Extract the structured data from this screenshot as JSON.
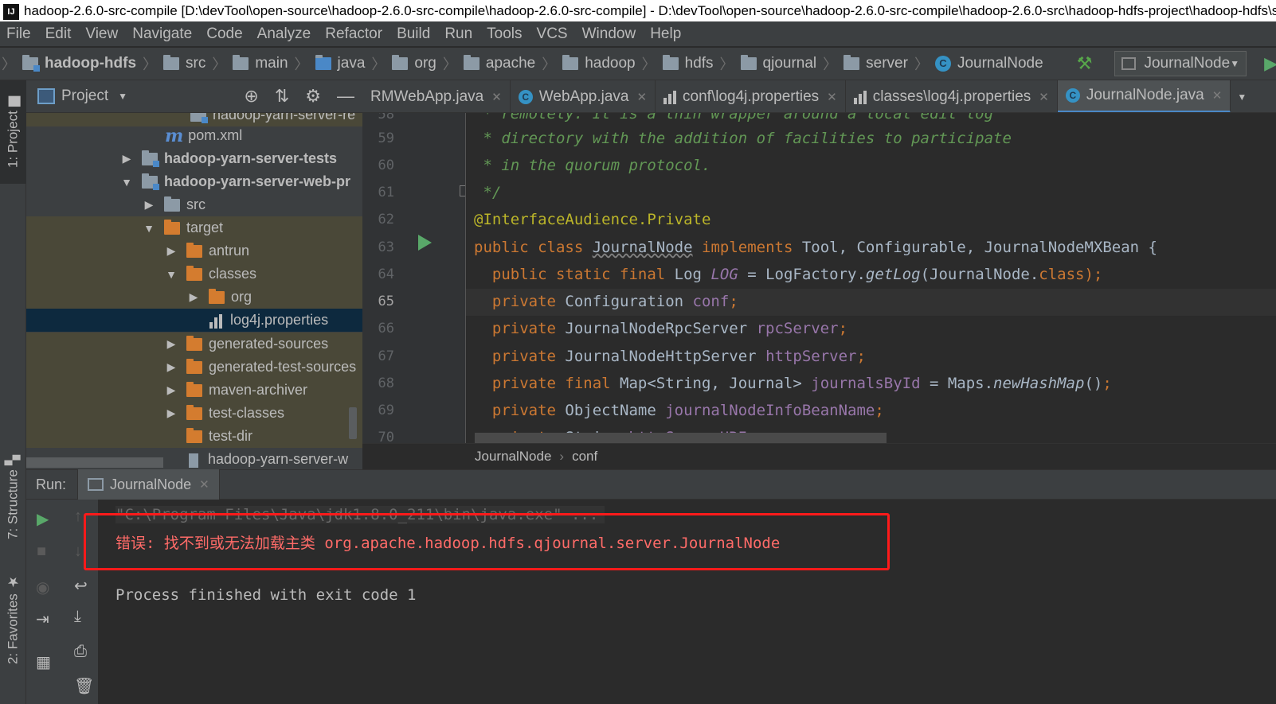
{
  "window": {
    "title": "hadoop-2.6.0-src-compile [D:\\devTool\\open-source\\hadoop-2.6.0-src-compile\\hadoop-2.6.0-src-compile] - D:\\devTool\\open-source\\hadoop-2.6.0-src-compile\\hadoop-2.6.0-src\\hadoop-hdfs-project\\hadoop-hdfs\\src\\main\\java\\org\\apache\\hadoop\\hdfs\\qjournal\\server\\JournalNode.java"
  },
  "menu": [
    "File",
    "Edit",
    "View",
    "Navigate",
    "Code",
    "Analyze",
    "Refactor",
    "Build",
    "Run",
    "Tools",
    "VCS",
    "Window",
    "Help"
  ],
  "nav": {
    "crumbs": [
      "hadoop-hdfs",
      "src",
      "main",
      "java",
      "org",
      "apache",
      "hadoop",
      "hdfs",
      "qjournal",
      "server",
      "JournalNode"
    ],
    "run_config": "JournalNode"
  },
  "left_stripe": {
    "project": "1: Project",
    "structure": "7: Structure",
    "favorites": "2: Favorites"
  },
  "project_panel": {
    "title": "Project",
    "tree": [
      {
        "label": "hadoop-yarn-server-re",
        "kind": "module"
      },
      {
        "label": "pom.xml",
        "kind": "pom"
      },
      {
        "label": "hadoop-yarn-server-tests",
        "kind": "module"
      },
      {
        "label": "hadoop-yarn-server-web-pr",
        "kind": "module"
      },
      {
        "label": "src",
        "kind": "folder"
      },
      {
        "label": "target",
        "kind": "folder"
      },
      {
        "label": "antrun",
        "kind": "folder"
      },
      {
        "label": "classes",
        "kind": "folder"
      },
      {
        "label": "org",
        "kind": "folder"
      },
      {
        "label": "log4j.properties",
        "kind": "properties"
      },
      {
        "label": "generated-sources",
        "kind": "folder"
      },
      {
        "label": "generated-test-sources",
        "kind": "folder"
      },
      {
        "label": "maven-archiver",
        "kind": "folder"
      },
      {
        "label": "test-classes",
        "kind": "folder"
      },
      {
        "label": "test-dir",
        "kind": "folder"
      },
      {
        "label": "hadoop-yarn-server-w",
        "kind": "file"
      }
    ]
  },
  "editor": {
    "tabs": [
      "RMWebApp.java",
      "WebApp.java",
      "conf\\log4j.properties",
      "classes\\log4j.properties",
      "JournalNode.java"
    ],
    "active_tab": "JournalNode.java",
    "line_numbers": [
      "58",
      "59",
      "60",
      "61",
      "62",
      "63",
      "64",
      "65",
      "66",
      "67",
      "68",
      "69",
      "70"
    ],
    "current_line": "65",
    "breadcrumbs": [
      "JournalNode",
      "conf"
    ]
  },
  "code": {
    "l58": " * remotely. It is a thin wrapper around a local edit log",
    "l59": " * directory with the addition of facilities to participate",
    "l60": " * in the quorum protocol.",
    "l61": " */",
    "l62_ann": "@InterfaceAudience",
    "l62_rest": ".Private",
    "l63_kw1": "public class ",
    "l63_name": "JournalNode",
    "l63_kw2": " implements ",
    "l63_rest": "Tool, Configurable, JournalNodeMXBean {",
    "l64_kw": "  public static final ",
    "l64_type": "Log ",
    "l64_field": "LOG",
    "l64_mid": " = LogFactory.",
    "l64_method": "getLog",
    "l64_arg": "(JournalNode.",
    "l64_cls": "class",
    "l64_end": ");",
    "l65_kw": "  private ",
    "l65_type": "Configuration ",
    "l65_field": "conf",
    "l66_kw": "  private ",
    "l66_type": "JournalNodeRpcServer ",
    "l66_field": "rpcServer",
    "l67_kw": "  private ",
    "l67_type": "JournalNodeHttpServer ",
    "l67_field": "httpServer",
    "l68_kw": "  private final ",
    "l68_type": "Map<String, Journal> ",
    "l68_field": "journalsById",
    "l68_mid": " = Maps.",
    "l68_method": "newHashMap",
    "l68_end": "()",
    "l69_kw": "  private ",
    "l69_type": "ObjectName ",
    "l69_field": "journalNodeInfoBeanName",
    "l70_kw": "  private ",
    "l70_type": "String ",
    "l70_field": "httpServerURI"
  },
  "run_window": {
    "label": "Run:",
    "tab": "JournalNode",
    "console": {
      "command": "\"C:\\Program Files\\Java\\jdk1.8.0_211\\bin\\java.exe\" ...",
      "error": "错误: 找不到或无法加载主类 org.apache.hadoop.hdfs.qjournal.server.JournalNode",
      "exit": "Process finished with exit code 1"
    }
  },
  "colors": {
    "error_text": "#ff6b68",
    "highlight_box": "#ff1a1a",
    "accent": "#4a88c7"
  }
}
